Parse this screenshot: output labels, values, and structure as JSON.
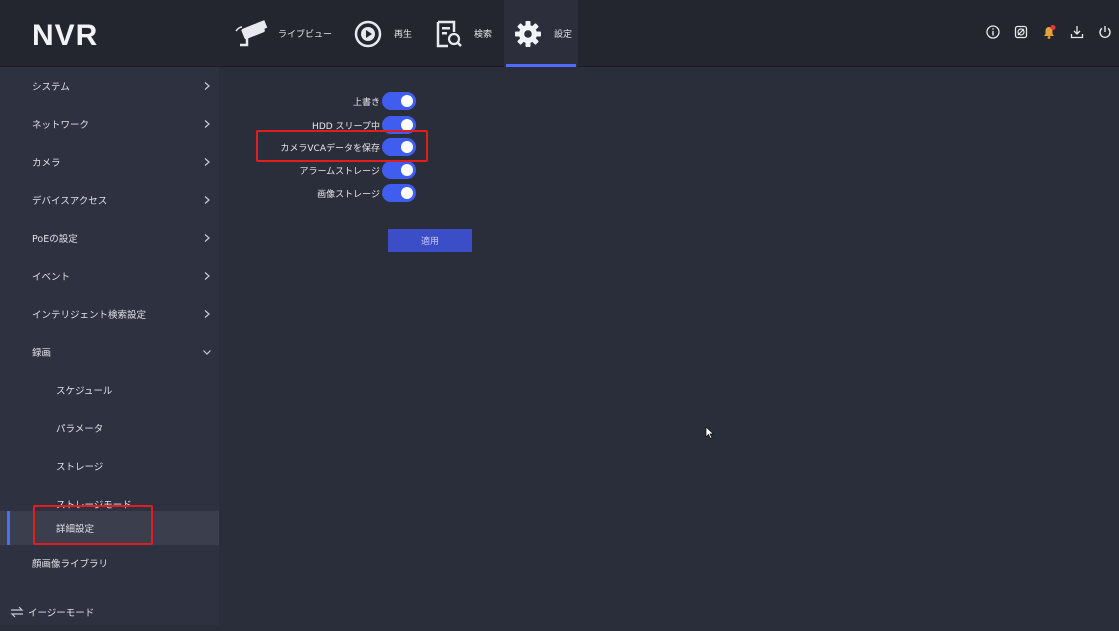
{
  "app": {
    "logo": "NVR"
  },
  "nav": [
    {
      "label": "ライブビュー",
      "icon": "camera-icon"
    },
    {
      "label": "再生",
      "icon": "playback-icon"
    },
    {
      "label": "検索",
      "icon": "search-file-icon"
    },
    {
      "label": "設定",
      "icon": "gear-icon",
      "active": true
    }
  ],
  "toolbar": [
    "info-icon",
    "hdd-icon",
    "alarm-bell-icon",
    "download-icon",
    "power-icon"
  ],
  "sidebar": {
    "items": [
      {
        "label": "システム"
      },
      {
        "label": "ネットワーク"
      },
      {
        "label": "カメラ"
      },
      {
        "label": "デバイスアクセス"
      },
      {
        "label": "PoEの設定"
      },
      {
        "label": "イベント"
      },
      {
        "label": "インテリジェント検索設定"
      },
      {
        "label": "録画"
      },
      {
        "label": "スケジュール"
      },
      {
        "label": "パラメータ"
      },
      {
        "label": "ストレージ"
      },
      {
        "label": "ストレージモード"
      },
      {
        "label": "詳細設定"
      },
      {
        "label": "顔画像ライブラリ"
      }
    ],
    "footer": "イージーモード"
  },
  "settings": {
    "rows": [
      {
        "label": "上書き",
        "enabled": true
      },
      {
        "label": "HDD スリープ中",
        "enabled": true
      },
      {
        "label": "カメラVCAデータを保存",
        "enabled": true
      },
      {
        "label": "アラームストレージ",
        "enabled": true
      },
      {
        "label": "画像ストレージ",
        "enabled": true
      }
    ],
    "apply_label": "適用"
  }
}
